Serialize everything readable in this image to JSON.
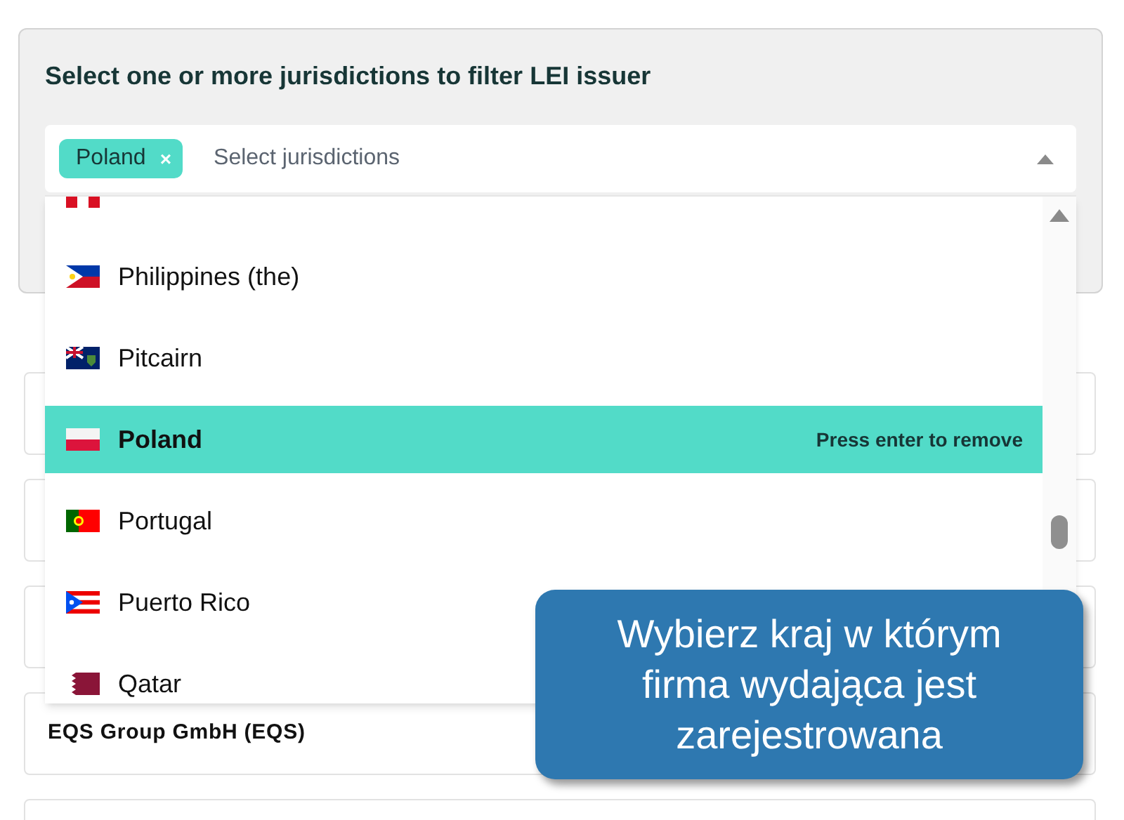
{
  "filter_panel": {
    "title": "Select one or more jurisdictions to filter LEI issuer",
    "select": {
      "chips": [
        {
          "label": "Poland",
          "remove": "×"
        }
      ],
      "placeholder": "Select jurisdictions",
      "expanded": true
    },
    "options": [
      {
        "label": "Philippines (the)",
        "selected": false
      },
      {
        "label": "Pitcairn",
        "selected": false
      },
      {
        "label": "Poland",
        "selected": true,
        "hint": "Press enter to remove"
      },
      {
        "label": "Portugal",
        "selected": false
      },
      {
        "label": "Puerto Rico",
        "selected": false
      },
      {
        "label": "Qatar",
        "selected": false
      }
    ]
  },
  "issuer_cards": [
    {
      "kind": "covered"
    },
    {
      "kind": "covered"
    },
    {
      "kind": "covered"
    },
    {
      "kind": "named",
      "label": "EQS Group GmbH (EQS)"
    },
    {
      "kind": "covered"
    }
  ],
  "callout": {
    "text": "Wybierz kraj w którym firma wydająca jest zarejestrowana"
  }
}
